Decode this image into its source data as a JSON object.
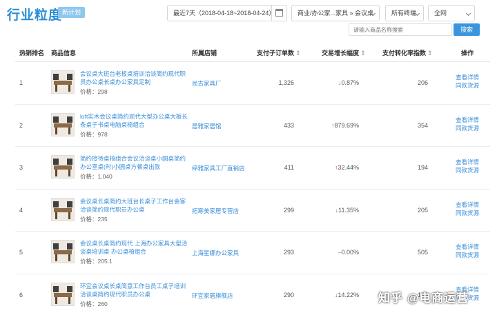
{
  "header": {
    "title": "行业粒度",
    "badge": "新计划",
    "date_range": "最近7天（2018-04-18~2018-04-24）",
    "category": "商业/办公家...家具 » 会议桌",
    "terminal": "所有终端",
    "network": "全网"
  },
  "search": {
    "placeholder": "请输入商品名称搜索",
    "button": "搜索"
  },
  "columns": {
    "rank": "热销排名",
    "product": "商品信息",
    "shop": "所属店铺",
    "orders": "支付子订单数",
    "growth": "交易增长幅度",
    "conversion": "支付转化率指数",
    "ops": "操作",
    "sort_glyph": "⇕"
  },
  "ops_labels": {
    "detail": "查看详情",
    "same_style": "同款货源"
  },
  "rows": [
    {
      "rank": "1",
      "name": "会议桌大班台老板桌培训洽谈简约现代职员办公桌长桌办公家具定制",
      "price": "价格：298",
      "shop": "尚古家具厂",
      "orders": "1,326",
      "growth": "0.87%",
      "trend": "down",
      "conversion": "206"
    },
    {
      "rank": "2",
      "name": "loft实木会议桌简约现代大型办公桌大板长条桌子书桌电脑桌椅组合",
      "price": "价格：978",
      "shop": "居雅家居馆",
      "orders": "433",
      "growth": "879.69%",
      "trend": "up",
      "conversion": "354"
    },
    {
      "rank": "3",
      "name": "简约接待桌椅组合会议洽谈桌小圆桌简约办公室桌(时)小圆桌方餐桌出款",
      "price": "价格：1,040",
      "shop": "缔雅家具工厂直销店",
      "orders": "411",
      "growth": "32.44%",
      "trend": "up",
      "conversion": "194"
    },
    {
      "rank": "4",
      "name": "会议桌长桌简约大班台长桌子工作台会客洽谈简约现代职员办公桌",
      "price": "价格：235",
      "shop": "拓寒美家居专营店",
      "orders": "299",
      "growth": "11.35%",
      "trend": "down",
      "conversion": "205"
    },
    {
      "rank": "5",
      "name": "会议桌长桌简约现代 上海办公家具大型洽谈桌培训桌 办公桌椅组合",
      "price": "价格：205.1",
      "shop": "上海星娜办公家具",
      "orders": "293",
      "growth": "0.00%",
      "trend": "flat",
      "conversion": "505"
    },
    {
      "rank": "6",
      "name": "环宜会议桌长桌简意工作台员工桌子培训洽谈桌简约现代职员办公桌",
      "price": "价格：260",
      "shop": "环宜家居旗舰店",
      "orders": "290",
      "growth": "14.22%",
      "trend": "down",
      "conversion": "166"
    }
  ],
  "trend_glyphs": {
    "up": "↑",
    "down": "↓",
    "flat": "–"
  },
  "watermark": "知乎 @电商运营"
}
